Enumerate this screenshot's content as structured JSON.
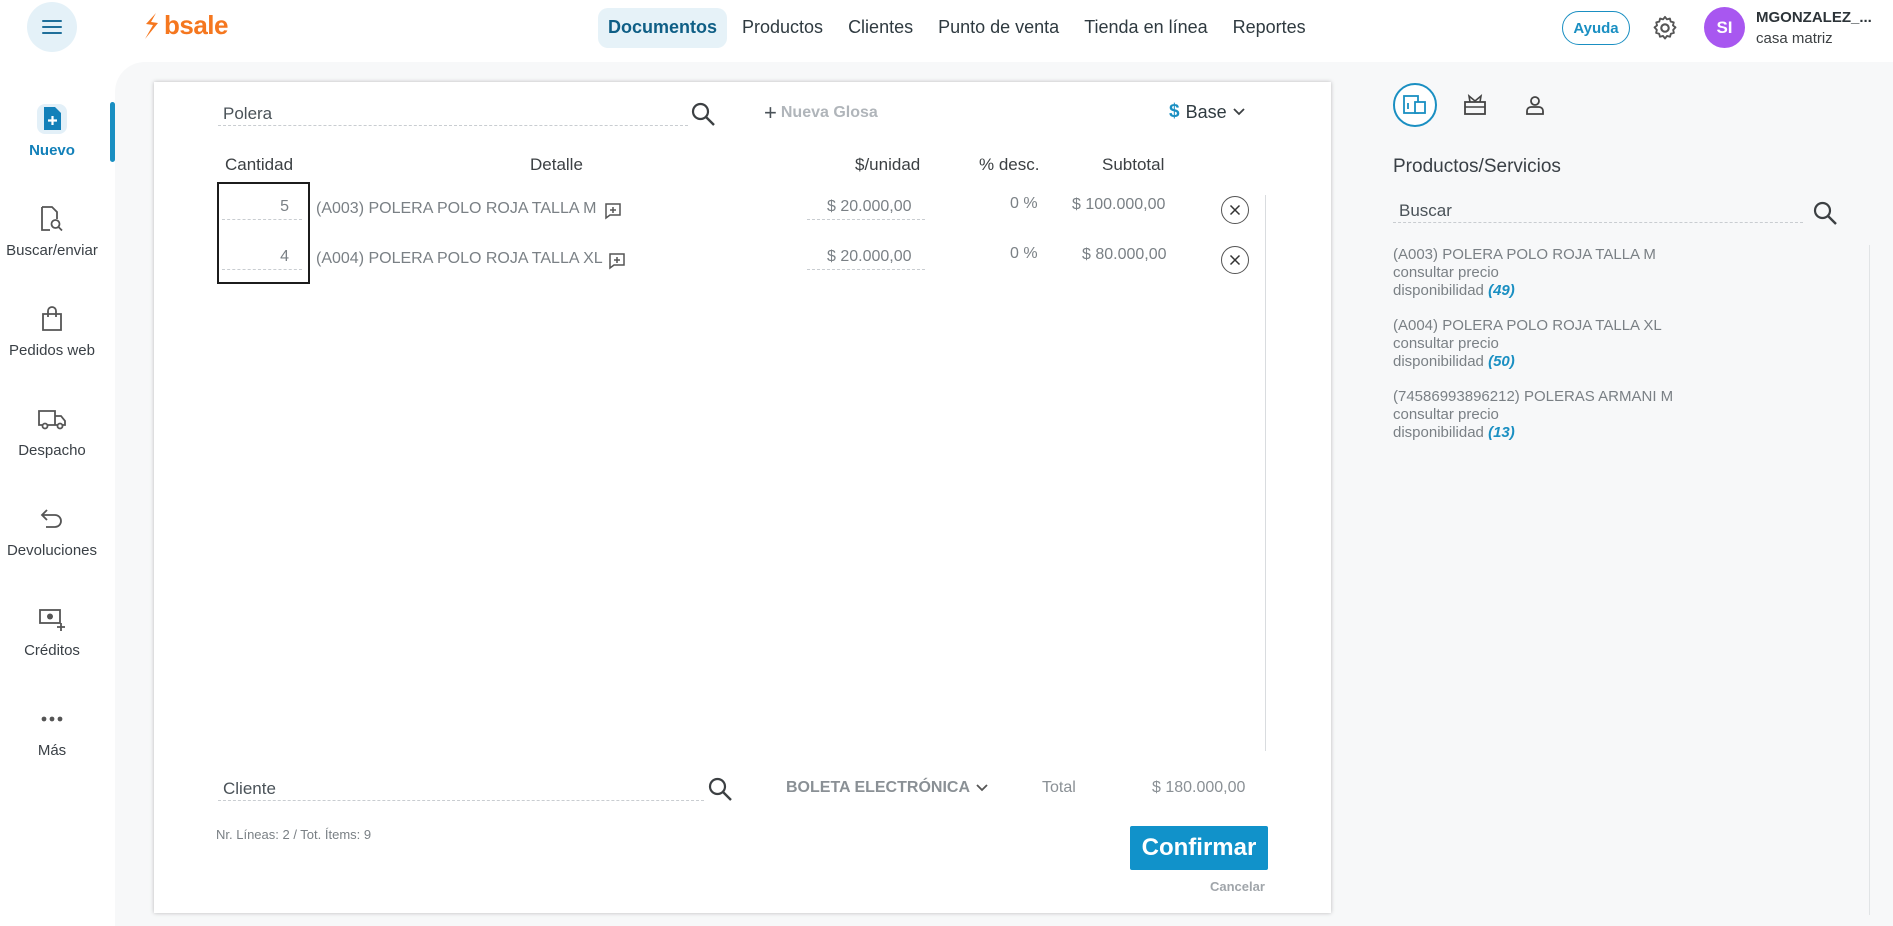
{
  "app": {
    "brand": "bsale"
  },
  "nav": [
    {
      "label": "Documentos",
      "active": true
    },
    {
      "label": "Productos"
    },
    {
      "label": "Clientes"
    },
    {
      "label": "Punto de venta"
    },
    {
      "label": "Tienda en línea"
    },
    {
      "label": "Reportes"
    }
  ],
  "header": {
    "help_label": "Ayuda",
    "avatar_initials": "SI",
    "user_name": "MGONZALEZ_...",
    "branch": "casa matriz"
  },
  "sidebar": [
    {
      "label": "Nuevo",
      "icon": "new-document-icon",
      "active": true
    },
    {
      "label": "Buscar/enviar",
      "icon": "search-document-icon"
    },
    {
      "label": "Pedidos web",
      "icon": "shopping-bag-icon"
    },
    {
      "label": "Despacho",
      "icon": "truck-icon"
    },
    {
      "label": "Devoluciones",
      "icon": "return-icon"
    },
    {
      "label": "Créditos",
      "icon": "money-plus-icon"
    },
    {
      "label": "Más",
      "icon": "more-icon"
    }
  ],
  "document": {
    "product_search_value": "Polera",
    "new_gloss_label": "Nueva Glosa",
    "price_list_symbol": "$",
    "price_list_label": "Base",
    "columns": {
      "qty": "Cantidad",
      "detail": "Detalle",
      "unit_price": "$/unidad",
      "discount": "% desc.",
      "subtotal": "Subtotal"
    },
    "lines": [
      {
        "qty": "5",
        "detail": "(A003) POLERA POLO ROJA TALLA M",
        "unit_price": "$ 20.000,00",
        "discount": "0 %",
        "subtotal": "$ 100.000,00"
      },
      {
        "qty": "4",
        "detail": "(A004) POLERA POLO ROJA TALLA XL",
        "unit_price": "$ 20.000,00",
        "discount": "0 %",
        "subtotal": "$ 80.000,00"
      }
    ],
    "client_placeholder": "Cliente",
    "doc_type": "BOLETA ELECTRÓNICA",
    "total_label": "Total",
    "total_value": "$ 180.000,00",
    "summary": "Nr. Líneas: 2 / Tot. Ítems: 9",
    "confirm_label": "Confirmar",
    "cancel_label": "Cancelar"
  },
  "right_panel": {
    "title": "Productos/Servicios",
    "search_placeholder": "Buscar",
    "products": [
      {
        "name": "(A003) POLERA POLO ROJA TALLA M",
        "price": "consultar precio",
        "avail_label": "disponibilidad",
        "avail": "(49)"
      },
      {
        "name": "(A004) POLERA POLO ROJA TALLA XL",
        "price": "consultar precio",
        "avail_label": "disponibilidad",
        "avail": "(50)"
      },
      {
        "name": "(74586993896212) POLERAS ARMANI M",
        "price": "consultar precio",
        "avail_label": "disponibilidad",
        "avail": "(13)"
      }
    ]
  },
  "colors": {
    "accent": "#1192ca",
    "brand": "#f5771f",
    "avatar": "#a857f0"
  }
}
